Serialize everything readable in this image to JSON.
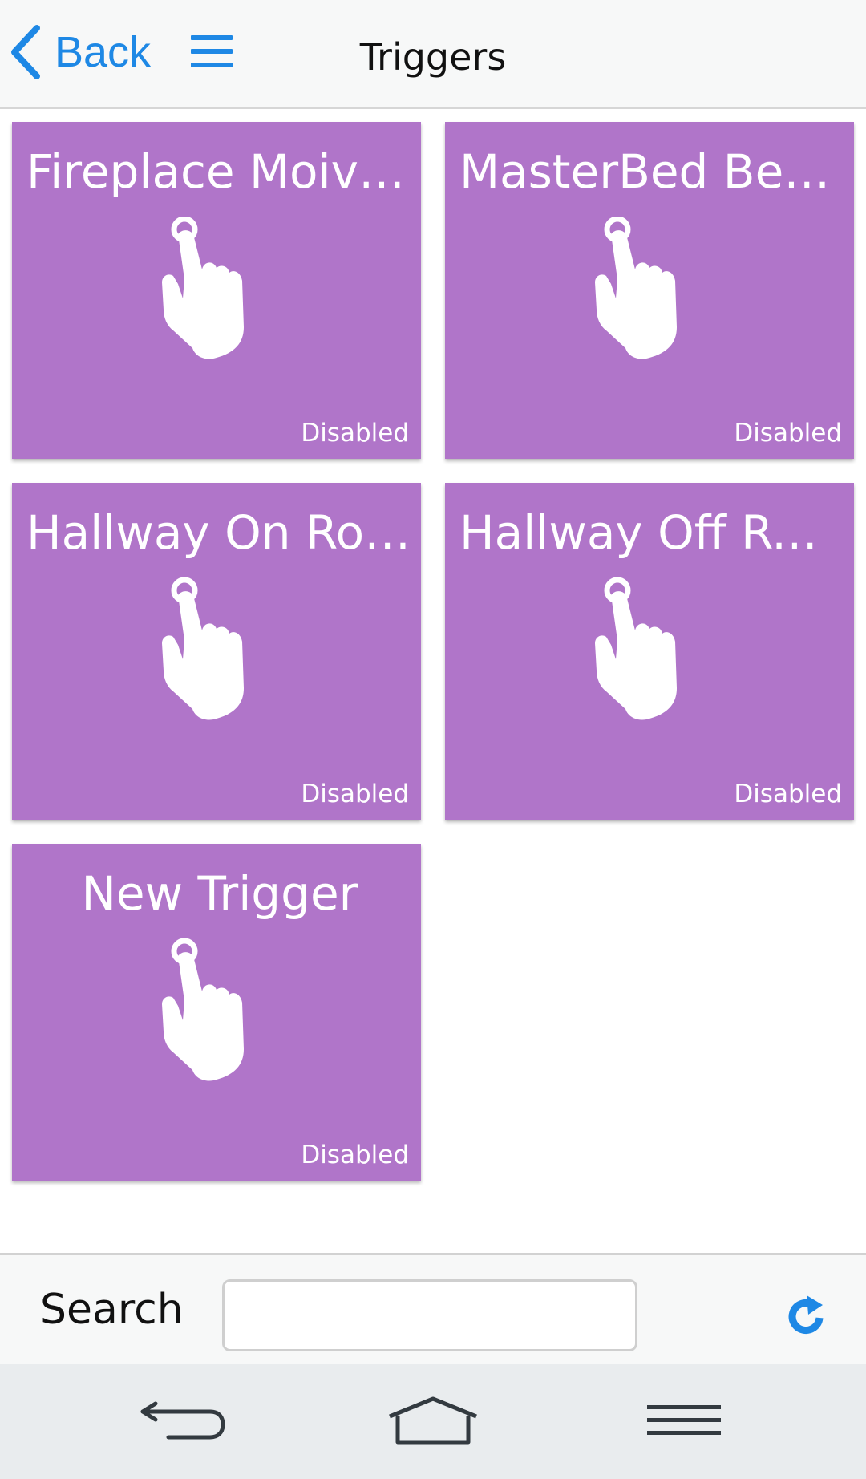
{
  "header": {
    "back_label": "Back",
    "title": "Triggers"
  },
  "triggers": [
    {
      "name": "Fireplace Moive ...",
      "status": "Disabled"
    },
    {
      "name": "MasterBed Bedt...",
      "status": "Disabled"
    },
    {
      "name": "Hallway On Rop...",
      "status": "Disabled"
    },
    {
      "name": "Hallway Off Rop...",
      "status": "Disabled"
    },
    {
      "name": "New Trigger",
      "status": "Disabled"
    }
  ],
  "search": {
    "label": "Search",
    "value": ""
  },
  "icons": {
    "back": "chevron-left-icon",
    "menu": "hamburger-menu-icon",
    "tile": "touch-hand-icon",
    "refresh": "refresh-icon",
    "nav_back": "system-back-icon",
    "nav_home": "system-home-icon",
    "nav_menu": "system-menu-icon"
  },
  "colors": {
    "accent": "#1e88e5",
    "tile": "#b075c9",
    "tile_text": "#ffffff"
  }
}
